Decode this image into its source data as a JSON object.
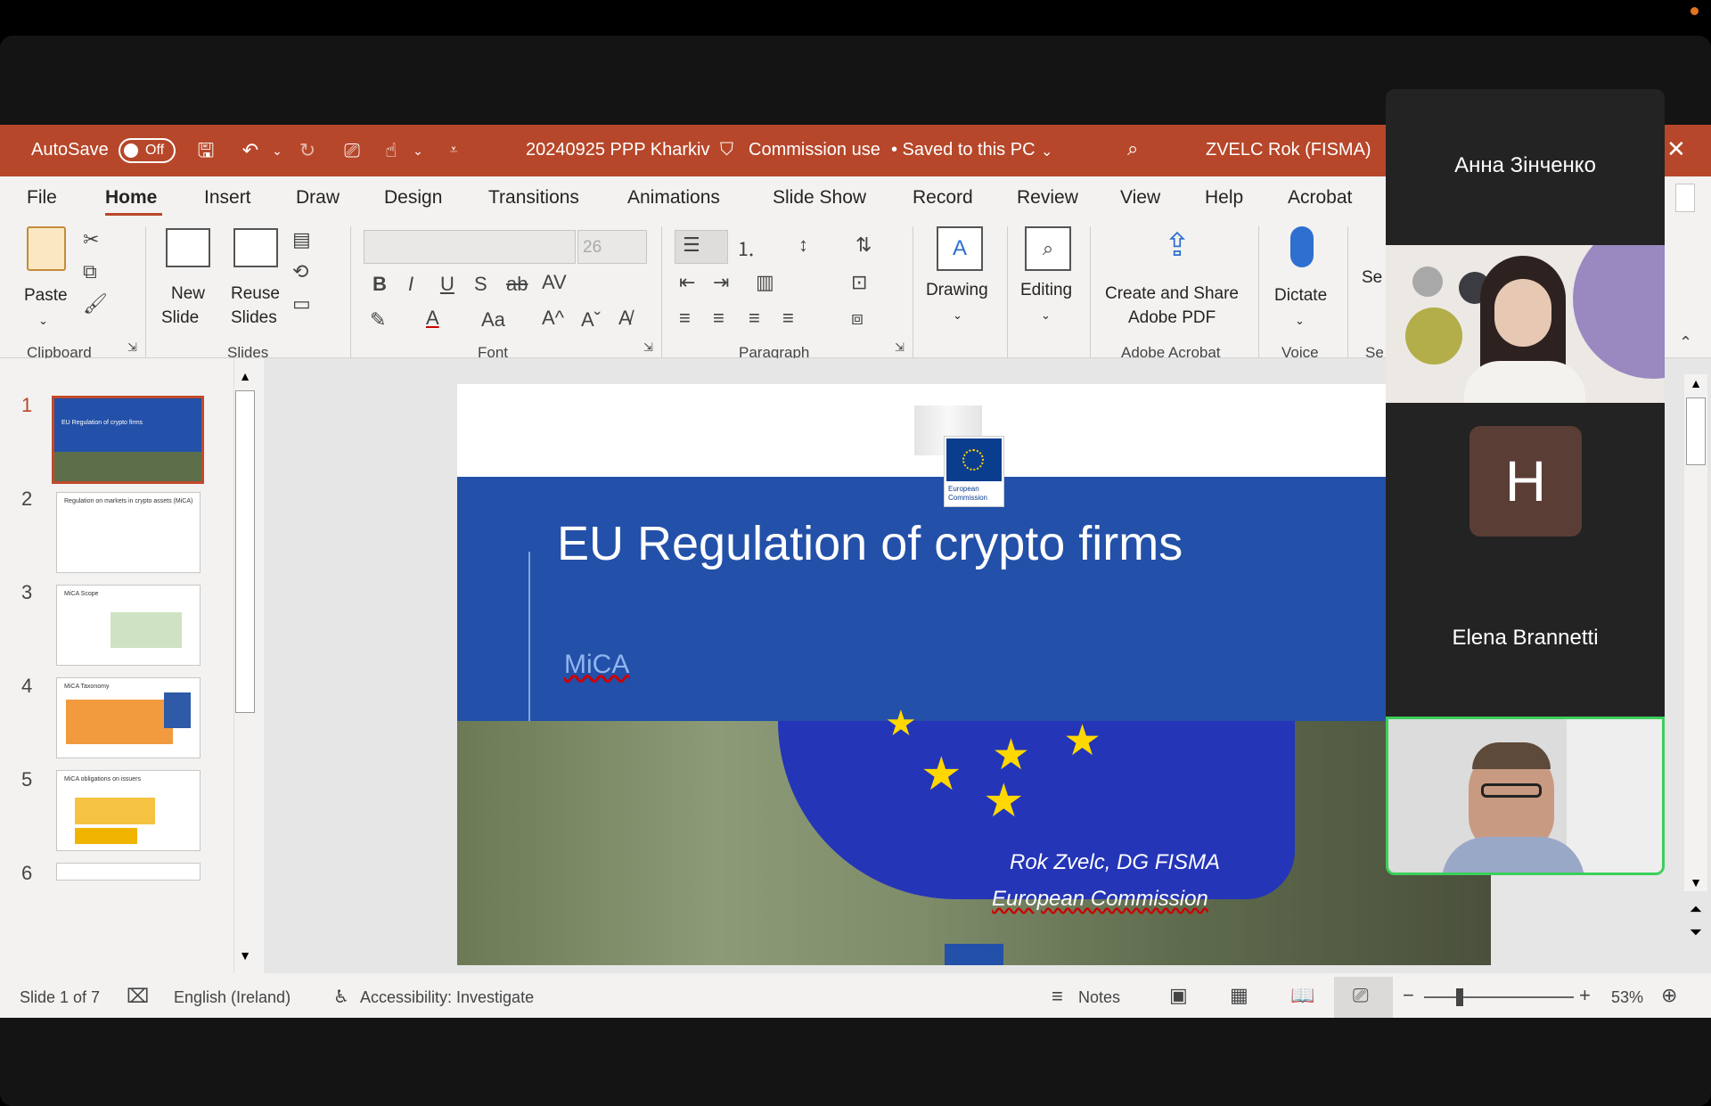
{
  "app": {
    "autosave_label": "AutoSave",
    "autosave_state": "Off",
    "document_title": "20240925 PPP Kharkiv",
    "sensitivity": "Commission use",
    "save_status": "• Saved to this PC",
    "user_name": "ZVELC Rok (FISMA)",
    "accent_color": "#b7472a"
  },
  "tabs": [
    "File",
    "Home",
    "Insert",
    "Draw",
    "Design",
    "Transitions",
    "Animations",
    "Slide Show",
    "Record",
    "Review",
    "View",
    "Help",
    "Acrobat"
  ],
  "ribbon": {
    "paste": "Paste",
    "new_slide_1": "New",
    "new_slide_2": "Slide",
    "reuse_1": "Reuse",
    "reuse_2": "Slides",
    "font_size": "26",
    "drawing": "Drawing",
    "editing": "Editing",
    "create_share_1": "Create and Share",
    "create_share_2": "Adobe PDF",
    "dictate": "Dictate",
    "cut_off": "Se",
    "group_clipboard": "Clipboard",
    "group_slides": "Slides",
    "group_font": "Font",
    "group_paragraph": "Paragraph",
    "group_acrobat": "Adobe Acrobat",
    "group_voice": "Voice",
    "group_cut": "Se"
  },
  "thumbnails": [
    {
      "num": "1",
      "title": "EU Regulation of crypto firms"
    },
    {
      "num": "2",
      "title": "Regulation on markets in crypto assets (MiCA)"
    },
    {
      "num": "3",
      "title": "MiCA Scope"
    },
    {
      "num": "4",
      "title": "MiCA Taxonomy"
    },
    {
      "num": "5",
      "title": "MiCA obligations on issuers"
    },
    {
      "num": "6",
      "title": ""
    }
  ],
  "slide": {
    "ec_logo_1": "European",
    "ec_logo_2": "Commission",
    "title": "EU Regulation of crypto firms",
    "subtitle": "MiCA",
    "author": "Rok Zvelc, DG FISMA",
    "org": "European Commission"
  },
  "status": {
    "slide_info": "Slide 1 of 7",
    "language": "English (Ireland)",
    "accessibility": "Accessibility: Investigate",
    "notes": "Notes",
    "zoom": "53%"
  },
  "participants": {
    "p1": "Анна Зінченко",
    "p2_initial": "H",
    "p2": "Elena Brannetti"
  }
}
